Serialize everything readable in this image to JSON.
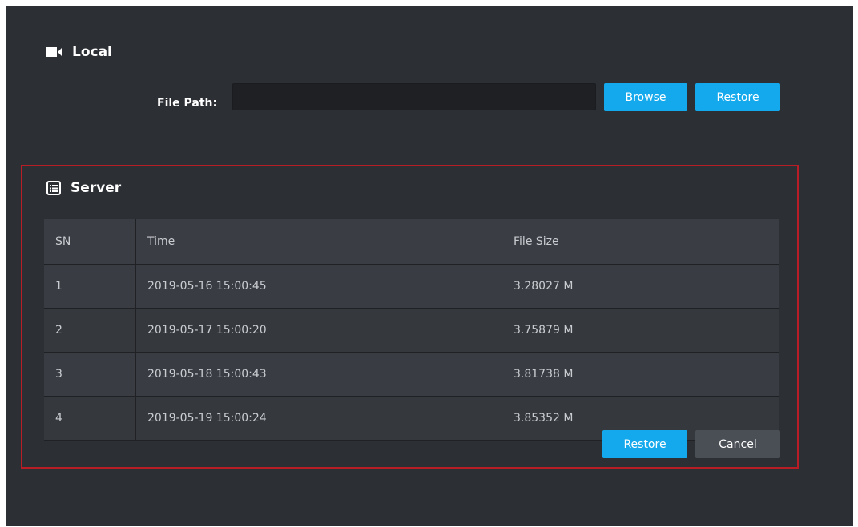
{
  "local": {
    "title": "Local",
    "icon": "video-camera-icon",
    "file_path_label": "File Path:",
    "file_path_value": "",
    "file_path_placeholder": "",
    "browse_label": "Browse",
    "restore_label": "Restore"
  },
  "server": {
    "title": "Server",
    "icon": "list-icon",
    "columns": [
      "SN",
      "Time",
      "File Size"
    ],
    "rows": [
      {
        "sn": "1",
        "time": "2019-05-16 15:00:45",
        "size": "3.28027 M"
      },
      {
        "sn": "2",
        "time": "2019-05-17 15:00:20",
        "size": "3.75879 M"
      },
      {
        "sn": "3",
        "time": "2019-05-18 15:00:43",
        "size": "3.81738 M"
      },
      {
        "sn": "4",
        "time": "2019-05-19 15:00:24",
        "size": "3.85352 M"
      }
    ],
    "restore_label": "Restore",
    "cancel_label": "Cancel"
  },
  "colors": {
    "background": "#2c2f34",
    "accent": "#14a9ec",
    "highlight_border": "#b81c24",
    "secondary_button": "#4a4e55"
  }
}
